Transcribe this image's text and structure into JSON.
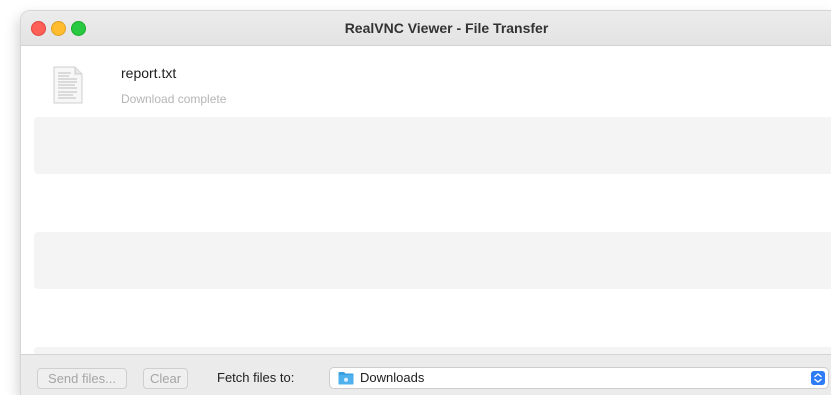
{
  "window": {
    "title": "RealVNC Viewer - File Transfer"
  },
  "transfers": [
    {
      "file_name": "report.txt",
      "status": "Download complete",
      "icon": "text-file-icon"
    }
  ],
  "footer": {
    "send_label": "Send files...",
    "clear_label": "Clear",
    "fetch_label": "Fetch files to:",
    "destination": "Downloads",
    "destination_icon": "folder-icon"
  },
  "colors": {
    "close": "#fe5f57",
    "minimize": "#febc2e",
    "maximize": "#28c840",
    "accent": "#2e7cf6",
    "folder": "#3a9fe0"
  }
}
